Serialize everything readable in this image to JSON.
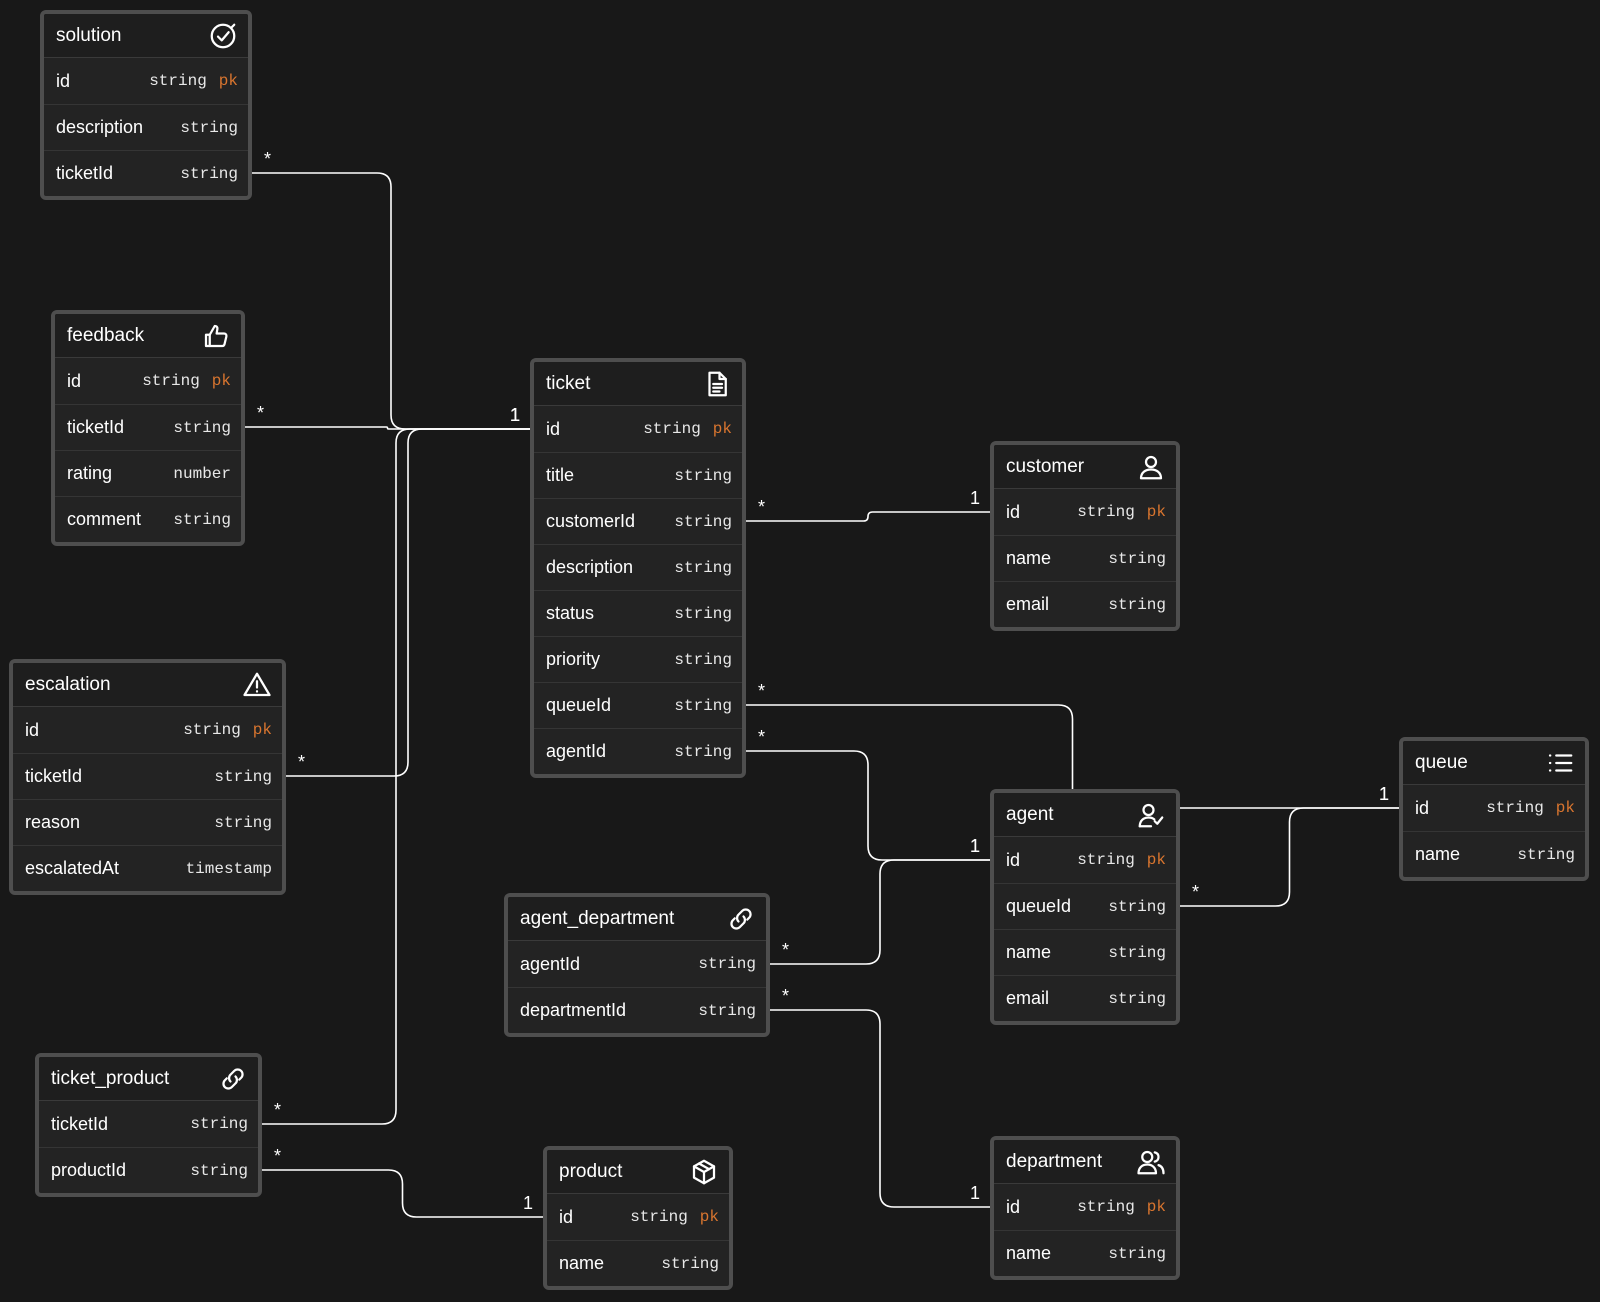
{
  "colors": {
    "background": "#181818",
    "card": "#232323",
    "border": "#4e4e4e",
    "pk": "#d9752f",
    "line": "#ffffff"
  },
  "entities": {
    "solution": {
      "title": "solution",
      "icon": "check-circle-icon",
      "fields": [
        {
          "name": "id",
          "type": "string",
          "pk": "pk"
        },
        {
          "name": "description",
          "type": "string"
        },
        {
          "name": "ticketId",
          "type": "string"
        }
      ]
    },
    "feedback": {
      "title": "feedback",
      "icon": "thumbs-up-icon",
      "fields": [
        {
          "name": "id",
          "type": "string",
          "pk": "pk"
        },
        {
          "name": "ticketId",
          "type": "string"
        },
        {
          "name": "rating",
          "type": "number"
        },
        {
          "name": "comment",
          "type": "string"
        }
      ]
    },
    "escalation": {
      "title": "escalation",
      "icon": "warning-triangle-icon",
      "fields": [
        {
          "name": "id",
          "type": "string",
          "pk": "pk"
        },
        {
          "name": "ticketId",
          "type": "string"
        },
        {
          "name": "reason",
          "type": "string"
        },
        {
          "name": "escalatedAt",
          "type": "timestamp"
        }
      ]
    },
    "ticket_product": {
      "title": "ticket_product",
      "icon": "link-icon",
      "fields": [
        {
          "name": "ticketId",
          "type": "string"
        },
        {
          "name": "productId",
          "type": "string"
        }
      ]
    },
    "ticket": {
      "title": "ticket",
      "icon": "document-icon",
      "fields": [
        {
          "name": "id",
          "type": "string",
          "pk": "pk"
        },
        {
          "name": "title",
          "type": "string"
        },
        {
          "name": "customerId",
          "type": "string"
        },
        {
          "name": "description",
          "type": "string"
        },
        {
          "name": "status",
          "type": "string"
        },
        {
          "name": "priority",
          "type": "string"
        },
        {
          "name": "queueId",
          "type": "string"
        },
        {
          "name": "agentId",
          "type": "string"
        }
      ]
    },
    "agent_department": {
      "title": "agent_department",
      "icon": "link-icon",
      "fields": [
        {
          "name": "agentId",
          "type": "string"
        },
        {
          "name": "departmentId",
          "type": "string"
        }
      ]
    },
    "product": {
      "title": "product",
      "icon": "box-icon",
      "fields": [
        {
          "name": "id",
          "type": "string",
          "pk": "pk"
        },
        {
          "name": "name",
          "type": "string"
        }
      ]
    },
    "customer": {
      "title": "customer",
      "icon": "user-icon",
      "fields": [
        {
          "name": "id",
          "type": "string",
          "pk": "pk"
        },
        {
          "name": "name",
          "type": "string"
        },
        {
          "name": "email",
          "type": "string"
        }
      ]
    },
    "agent": {
      "title": "agent",
      "icon": "user-check-icon",
      "fields": [
        {
          "name": "id",
          "type": "string",
          "pk": "pk"
        },
        {
          "name": "queueId",
          "type": "string"
        },
        {
          "name": "name",
          "type": "string"
        },
        {
          "name": "email",
          "type": "string"
        }
      ]
    },
    "department": {
      "title": "department",
      "icon": "users-icon",
      "fields": [
        {
          "name": "id",
          "type": "string",
          "pk": "pk"
        },
        {
          "name": "name",
          "type": "string"
        }
      ]
    },
    "queue": {
      "title": "queue",
      "icon": "list-icon",
      "fields": [
        {
          "name": "id",
          "type": "string",
          "pk": "pk"
        },
        {
          "name": "name",
          "type": "string"
        }
      ]
    }
  },
  "relationships": [
    {
      "from": "solution.ticketId",
      "to": "ticket.id",
      "from_card": "*",
      "to_card": "1"
    },
    {
      "from": "feedback.ticketId",
      "to": "ticket.id",
      "from_card": "*",
      "to_card": "1"
    },
    {
      "from": "escalation.ticketId",
      "to": "ticket.id",
      "from_card": "*",
      "to_card": "1"
    },
    {
      "from": "ticket_product.ticketId",
      "to": "ticket.id",
      "from_card": "*",
      "to_card": "1"
    },
    {
      "from": "ticket_product.productId",
      "to": "product.id",
      "from_card": "*",
      "to_card": "1"
    },
    {
      "from": "ticket.customerId",
      "to": "customer.id",
      "from_card": "*",
      "to_card": "1"
    },
    {
      "from": "ticket.queueId",
      "to": "queue.id",
      "from_card": "*",
      "to_card": "1"
    },
    {
      "from": "ticket.agentId",
      "to": "agent.id",
      "from_card": "*",
      "to_card": "1"
    },
    {
      "from": "agent_department.agentId",
      "to": "agent.id",
      "from_card": "*",
      "to_card": "1"
    },
    {
      "from": "agent_department.departmentId",
      "to": "department.id",
      "from_card": "*",
      "to_card": "1"
    },
    {
      "from": "agent.queueId",
      "to": "queue.id",
      "from_card": "*",
      "to_card": "1"
    }
  ]
}
